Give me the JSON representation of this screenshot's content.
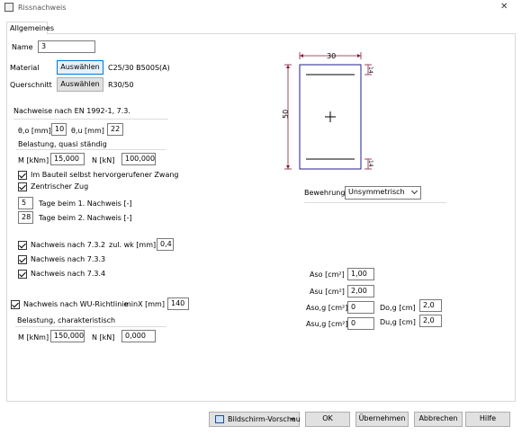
{
  "window": {
    "title": "Rissnachweis",
    "close_glyph": "✕"
  },
  "tabs": [
    {
      "label": "Allgemeines"
    }
  ],
  "general": {
    "name_label": "Name",
    "name_value": "3",
    "material_label": "Material",
    "material_button": "Auswählen",
    "material_value": "C25/30 B500S(A)",
    "section_label": "Querschnitt",
    "section_button": "Auswählen",
    "section_value": "R30/50"
  },
  "en_check": {
    "heading": "Nachweise nach EN 1992-1, 7.3.",
    "theta_o_label": "θ,o [mm]",
    "theta_o_value": "10",
    "theta_u_label": "θ,u [mm]",
    "theta_u_value": "22",
    "load_heading": "Belastung, quasi ständig",
    "m_label": "M [kNm]",
    "m_value": "15,000",
    "n_label": "N [kN]",
    "n_value": "100,000",
    "cb_constraint": {
      "label": "Im Bauteil selbst hervorgerufener Zwang",
      "checked": true
    },
    "cb_tension": {
      "label": "Zentrischer Zug",
      "checked": true
    },
    "days1_value": "5",
    "days1_label": "Tage beim 1. Nachweis [-]",
    "days2_value": "28",
    "days2_label": "Tage beim 2. Nachweis [-]",
    "cb_732": {
      "label": "Nachweis nach 7.3.2",
      "checked": true
    },
    "wk_label": "zul. wk [mm]",
    "wk_value": "0,4",
    "cb_733": {
      "label": "Nachweis nach 7.3.3",
      "checked": true
    },
    "cb_734": {
      "label": "Nachweis nach 7.3.4",
      "checked": true
    }
  },
  "wu_check": {
    "cb_wu": {
      "label": "Nachweis nach WU-Richtlinie",
      "checked": true
    },
    "minx_label": "minX [mm]",
    "minx_value": "140",
    "load_heading": "Belastung, charakteristisch",
    "m_label": "M [kNm]",
    "m_value": "150,000",
    "n_label": "N [kN]",
    "n_value": "0,000"
  },
  "section_drawing": {
    "width_label": "30",
    "height_label": "50",
    "cover_top": "14",
    "cover_bottom": "14"
  },
  "reinforcement": {
    "label": "Bewehrung",
    "selected": "Unsymmetrisch",
    "aso_label": "Aso [cm²]",
    "aso_value": "1,00",
    "asu_label": "Asu [cm²]",
    "asu_value": "2,00",
    "asog_label": "Aso,g [cm²]",
    "asog_value": "0",
    "asug_label": "Asu,g [cm²]",
    "asug_value": "0",
    "dog_label": "Do,g [cm]",
    "dog_value": "2,0",
    "dug_label": "Du,g [cm]",
    "dug_value": "2,0"
  },
  "footer": {
    "preview": "Bildschirm-Vorschau",
    "ok": "OK",
    "apply": "Übernehmen",
    "cancel": "Abbrechen",
    "help": "Hilfe"
  },
  "colors": {
    "accent": "#0078d7",
    "section_outline": "#1f1f8f",
    "dimension": "#8b1a3a"
  }
}
